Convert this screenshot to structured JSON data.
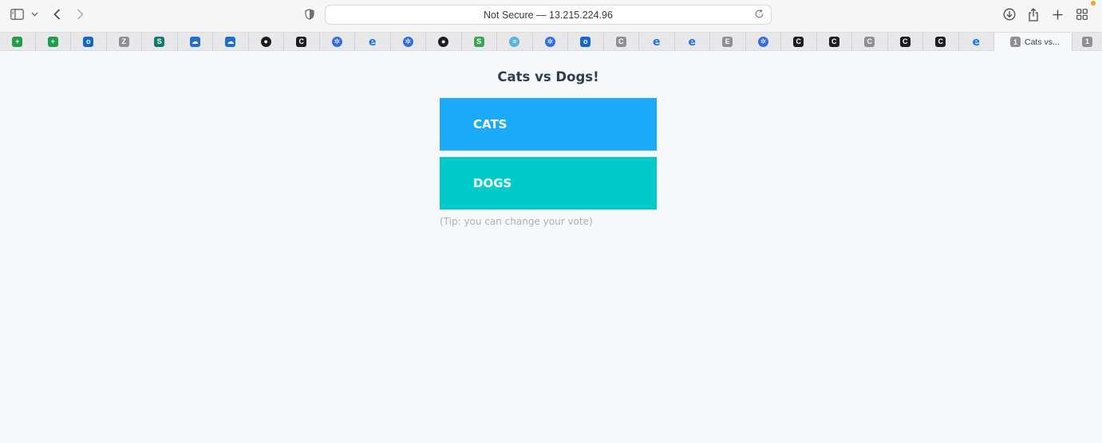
{
  "browser": {
    "address_text": "Not Secure — 13.215.224.96",
    "icons": {
      "sidebar": "sidebar-icon",
      "sidebar_menu": "chevron-down-icon",
      "back": "chevron-left-icon",
      "forward": "chevron-right-icon",
      "privacy": "shield-icon",
      "reload": "reload-icon",
      "download": "download-icon",
      "share": "share-icon",
      "new_tab": "plus-icon",
      "tab_overview": "grid-icon"
    },
    "pinned_tabs": [
      {
        "icon": "sheets-icon",
        "glyph": "+",
        "color": "#1e9e4a"
      },
      {
        "icon": "sheets-icon",
        "glyph": "+",
        "color": "#1e9e4a"
      },
      {
        "icon": "outlook-icon",
        "glyph": "o",
        "color": "#1668c7"
      },
      {
        "icon": "zoom-icon",
        "glyph": "Z",
        "color": "#8e8e93"
      },
      {
        "icon": "sharepoint-icon",
        "glyph": "S",
        "color": "#0f7b6c"
      },
      {
        "icon": "onedrive-icon",
        "glyph": "☁",
        "color": "#1f6fd1"
      },
      {
        "icon": "onedrive-icon",
        "glyph": "☁",
        "color": "#1f6fd1"
      },
      {
        "icon": "github-icon",
        "glyph": "●",
        "color": "#1d1d1f"
      },
      {
        "icon": "notion-icon",
        "glyph": "C",
        "color": "#1d1d1f"
      },
      {
        "icon": "kubernetes-icon",
        "glyph": "✲",
        "color": "#326ce5"
      },
      {
        "icon": "edge-icon",
        "glyph": "e",
        "color": "#1a73e8"
      },
      {
        "icon": "kubernetes-icon",
        "glyph": "✲",
        "color": "#326ce5"
      },
      {
        "icon": "github-icon",
        "glyph": "●",
        "color": "#1d1d1f"
      },
      {
        "icon": "feedly-icon",
        "glyph": "S",
        "color": "#3aa655"
      },
      {
        "icon": "cisco-icon",
        "glyph": "≡",
        "color": "#58b4e0"
      },
      {
        "icon": "kubernetes-icon",
        "glyph": "✲",
        "color": "#326ce5"
      },
      {
        "icon": "outlook-icon",
        "glyph": "o",
        "color": "#1668c7"
      },
      {
        "icon": "c-icon",
        "glyph": "C",
        "color": "#8e8e93"
      },
      {
        "icon": "edge-icon",
        "glyph": "e",
        "color": "#1a73e8"
      },
      {
        "icon": "edge-icon",
        "glyph": "e",
        "color": "#1a73e8"
      },
      {
        "icon": "e-icon",
        "glyph": "E",
        "color": "#8e8e93"
      },
      {
        "icon": "kubernetes-icon",
        "glyph": "✲",
        "color": "#326ce5"
      },
      {
        "icon": "notion-icon",
        "glyph": "C",
        "color": "#1d1d1f"
      },
      {
        "icon": "notion-icon",
        "glyph": "C",
        "color": "#1d1d1f"
      },
      {
        "icon": "c-icon",
        "glyph": "C",
        "color": "#8e8e93"
      },
      {
        "icon": "notion-icon",
        "glyph": "C",
        "color": "#1d1d1f"
      },
      {
        "icon": "notion-icon",
        "glyph": "C",
        "color": "#1d1d1f"
      },
      {
        "icon": "edge-icon",
        "glyph": "e",
        "color": "#1a73e8"
      }
    ],
    "active_tab": {
      "badge": "1",
      "label": "Cats vs..."
    },
    "last_tab": {
      "badge": "1"
    }
  },
  "page": {
    "title": "Cats vs Dogs!",
    "option_a": "CATS",
    "option_b": "DOGS",
    "tip": "(Tip: you can change your vote)",
    "colors": {
      "cats": "#1aaaf8",
      "dogs": "#00cbca",
      "title": "#2c3e50"
    }
  }
}
